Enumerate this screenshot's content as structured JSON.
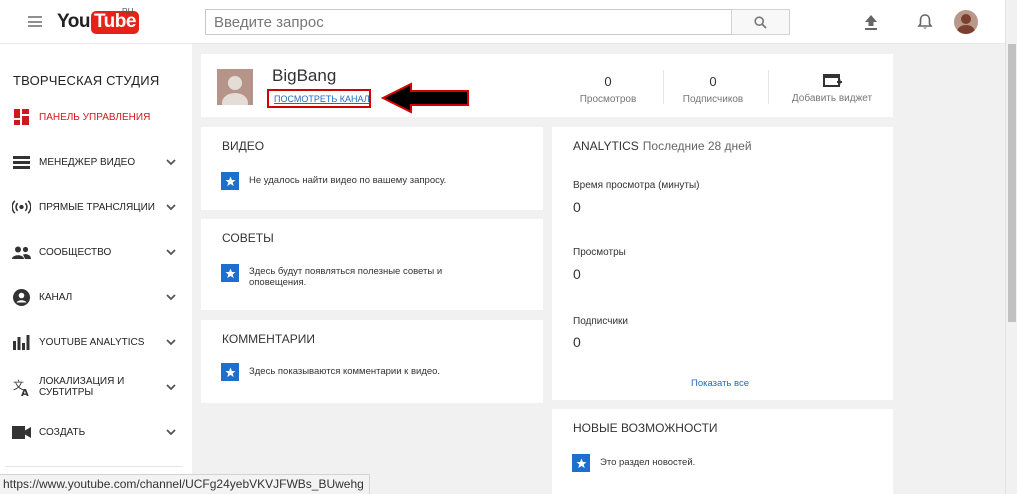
{
  "header": {
    "logo_you": "You",
    "logo_tube": "Tube",
    "logo_region": "RU",
    "search_placeholder": "Введите запрос"
  },
  "sidebar": {
    "title": "ТВОРЧЕСКАЯ СТУДИЯ",
    "items": [
      {
        "label": "ПАНЕЛЬ УПРАВЛЕНИЯ",
        "icon": "dashboard-icon",
        "active": true
      },
      {
        "label": "МЕНЕДЖЕР ВИДЕО",
        "icon": "video-manager-icon",
        "active": false
      },
      {
        "label": "ПРЯМЫЕ ТРАНСЛЯЦИИ",
        "icon": "live-broadcast-icon",
        "active": false
      },
      {
        "label": "СООБЩЕСТВО",
        "icon": "community-icon",
        "active": false
      },
      {
        "label": "КАНАЛ",
        "icon": "channel-icon",
        "active": false
      },
      {
        "label": "YOUTUBE ANALYTICS",
        "icon": "analytics-icon",
        "active": false
      },
      {
        "label": "ЛОКАЛИЗАЦИЯ И СУБТИТРЫ",
        "icon": "translate-icon",
        "active": false
      },
      {
        "label": "СОЗДАТЬ",
        "icon": "create-video-icon",
        "active": false
      }
    ]
  },
  "status_url": "https://www.youtube.com/channel/UCFg24yebVKVJFWBs_BUwehg",
  "channel": {
    "name": "BigBang",
    "view_channel_label": "ПОСМОТРЕТЬ КАНАЛ",
    "views_count": "0",
    "views_label": "Просмотров",
    "subscribers_count": "0",
    "subscribers_label": "Подписчиков",
    "add_widget_label": "Добавить виджет"
  },
  "video_section": {
    "title": "ВИДЕО",
    "message": "Не удалось найти видео по вашему запросу."
  },
  "tips_section": {
    "title": "СОВЕТЫ",
    "message": "Здесь будут появляться полезные советы и оповещения."
  },
  "comments_section": {
    "title": "КОММЕНТАРИИ",
    "message": "Здесь показываются комментарии к видео."
  },
  "analytics": {
    "title": "ANALYTICS",
    "period": "Последние 28 дней",
    "watch_time_label": "Время просмотра (минуты)",
    "watch_time_value": "0",
    "views_label": "Просмотры",
    "views_value": "0",
    "subscribers_label": "Подписчики",
    "subscribers_value": "0",
    "show_all_label": "Показать все"
  },
  "news_section": {
    "title": "НОВЫЕ ВОЗМОЖНОСТИ",
    "message": "Это раздел новостей."
  },
  "colors": {
    "brand_red": "#e62117",
    "link_blue": "#1b6dbd",
    "annotation_red": "#d40000",
    "info_icon_blue": "#1c6fd0"
  }
}
